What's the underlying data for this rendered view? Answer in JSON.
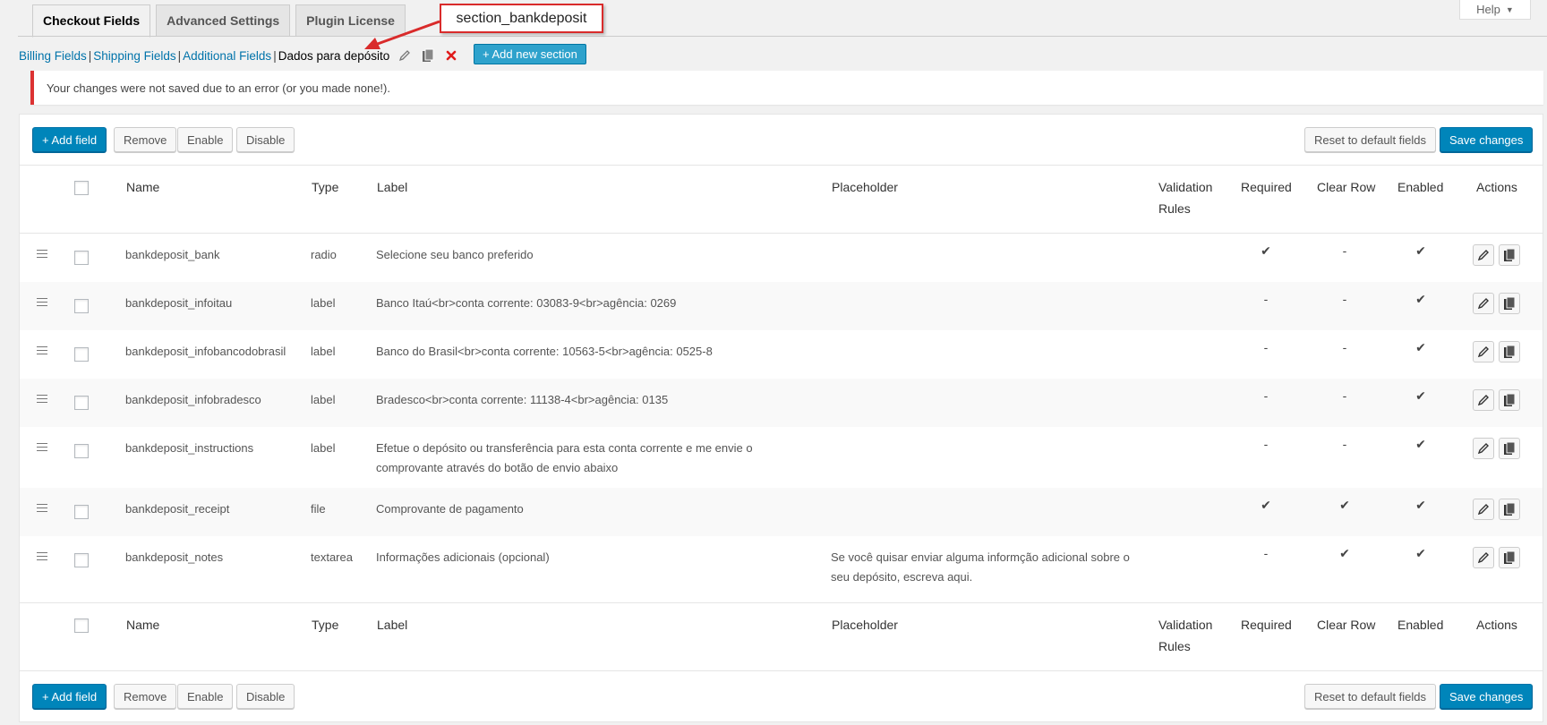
{
  "tabs": [
    {
      "label": "Checkout Fields",
      "active": true
    },
    {
      "label": "Advanced Settings",
      "active": false
    },
    {
      "label": "Plugin License",
      "active": false
    }
  ],
  "help": {
    "label": "Help"
  },
  "annotation": {
    "text": "section_bankdeposit",
    "color": "#d92b2b"
  },
  "sections": {
    "links": [
      "Billing Fields",
      "Shipping Fields",
      "Additional Fields"
    ],
    "separator": "|",
    "current": "Dados para depósito",
    "add_section_label": "+ Add new section"
  },
  "notice": {
    "text": "Your changes were not saved due to an error (or you made none!)."
  },
  "toolbar": {
    "add_field": "+ Add field",
    "remove": "Remove",
    "enable": "Enable",
    "disable": "Disable",
    "reset": "Reset to default fields",
    "save": "Save changes"
  },
  "columns": {
    "name": "Name",
    "type": "Type",
    "label": "Label",
    "placeholder": "Placeholder",
    "validation_1": "Validation",
    "validation_2": "Rules",
    "required": "Required",
    "clear_row": "Clear Row",
    "enabled": "Enabled",
    "actions": "Actions"
  },
  "rows": [
    {
      "name": "bankdeposit_bank",
      "type": "radio",
      "label_1": "Selecione seu banco preferido",
      "label_2": "",
      "placeholder_1": "",
      "placeholder_2": "",
      "required": "✔",
      "clear_row": "-",
      "enabled": "✔"
    },
    {
      "name": "bankdeposit_infoitau",
      "type": "label",
      "label_1": "Banco Itaú<br>conta corrente: 03083-9<br>agência: 0269",
      "label_2": "",
      "placeholder_1": "",
      "placeholder_2": "",
      "required": "-",
      "clear_row": "-",
      "enabled": "✔"
    },
    {
      "name": "bankdeposit_infobancodobrasil",
      "type": "label",
      "label_1": "Banco do Brasil<br>conta corrente: 10563-5<br>agência: 0525-8",
      "label_2": "",
      "placeholder_1": "",
      "placeholder_2": "",
      "required": "-",
      "clear_row": "-",
      "enabled": "✔"
    },
    {
      "name": "bankdeposit_infobradesco",
      "type": "label",
      "label_1": "Bradesco<br>conta corrente: 11138-4<br>agência: 0135",
      "label_2": "",
      "placeholder_1": "",
      "placeholder_2": "",
      "required": "-",
      "clear_row": "-",
      "enabled": "✔"
    },
    {
      "name": "bankdeposit_instructions",
      "type": "label",
      "label_1": "Efetue o depósito ou transferência para esta conta corrente e me envie o",
      "label_2": "comprovante através do botão de envio abaixo",
      "placeholder_1": "",
      "placeholder_2": "",
      "required": "-",
      "clear_row": "-",
      "enabled": "✔"
    },
    {
      "name": "bankdeposit_receipt",
      "type": "file",
      "label_1": "Comprovante de pagamento",
      "label_2": "",
      "placeholder_1": "",
      "placeholder_2": "",
      "required": "✔",
      "clear_row": "✔",
      "enabled": "✔"
    },
    {
      "name": "bankdeposit_notes",
      "type": "textarea",
      "label_1": "Informações adicionais (opcional)",
      "label_2": "",
      "placeholder_1": "Se você quisar enviar alguma informção adicional sobre o",
      "placeholder_2": "seu depósito, escreva aqui.",
      "required": "-",
      "clear_row": "✔",
      "enabled": "✔"
    }
  ],
  "colors": {
    "primary": "#0085ba",
    "link": "#0073aa",
    "error": "#dc3232"
  }
}
